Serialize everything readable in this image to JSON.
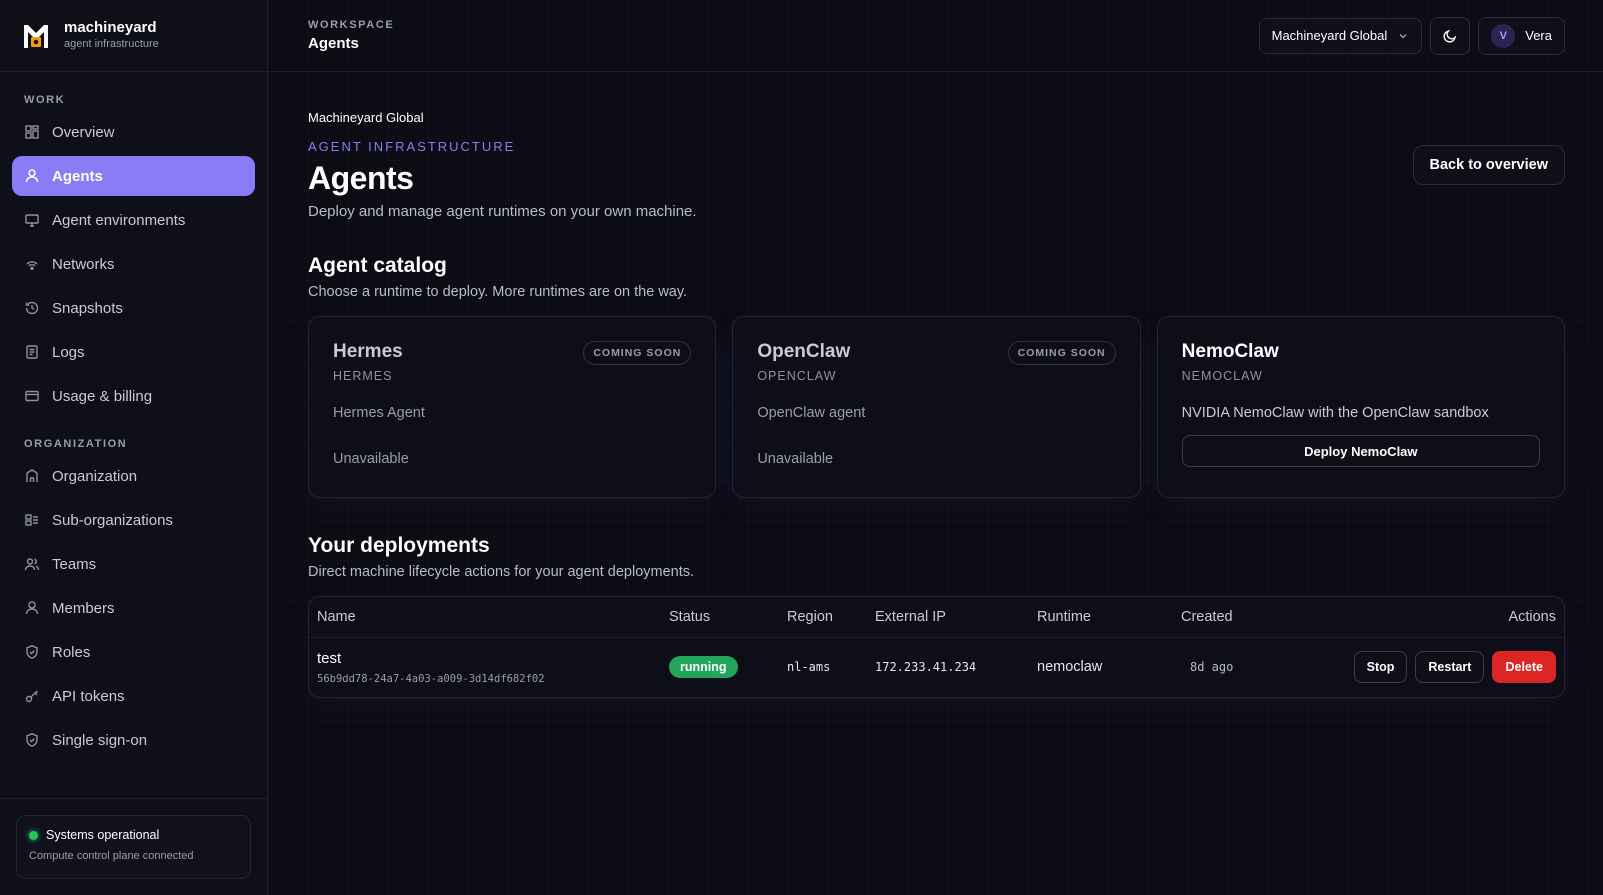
{
  "brand": {
    "name": "machineyard",
    "tagline": "agent infrastructure"
  },
  "sidebar": {
    "sections": [
      {
        "heading": "WORK",
        "items": [
          {
            "label": "Overview",
            "icon": "grid-icon"
          },
          {
            "label": "Agents",
            "icon": "user-icon",
            "active": true
          },
          {
            "label": "Agent environments",
            "icon": "monitor-icon"
          },
          {
            "label": "Networks",
            "icon": "wifi-icon"
          },
          {
            "label": "Snapshots",
            "icon": "history-icon"
          },
          {
            "label": "Logs",
            "icon": "document-icon"
          },
          {
            "label": "Usage & billing",
            "icon": "card-icon"
          }
        ]
      },
      {
        "heading": "ORGANIZATION",
        "items": [
          {
            "label": "Organization",
            "icon": "building-icon"
          },
          {
            "label": "Sub-organizations",
            "icon": "suborg-icon"
          },
          {
            "label": "Teams",
            "icon": "users-icon"
          },
          {
            "label": "Members",
            "icon": "user-icon"
          },
          {
            "label": "Roles",
            "icon": "shield-check-icon"
          },
          {
            "label": "API tokens",
            "icon": "key-icon"
          },
          {
            "label": "Single sign-on",
            "icon": "shield-check-icon"
          }
        ]
      }
    ],
    "status": {
      "title": "Systems operational",
      "detail": "Compute control plane connected"
    }
  },
  "topbar": {
    "crumb_label": "WORKSPACE",
    "crumb_title": "Agents",
    "org_select": "Machineyard Global",
    "user": {
      "initial": "V",
      "name": "Vera"
    }
  },
  "page": {
    "org_name": "Machineyard Global",
    "eyebrow": "AGENT INFRASTRUCTURE",
    "title": "Agents",
    "subtitle": "Deploy and manage agent runtimes on your own machine.",
    "back_button": "Back to overview"
  },
  "catalog": {
    "title": "Agent catalog",
    "subtitle": "Choose a runtime to deploy. More runtimes are on the way.",
    "cards": [
      {
        "name": "Hermes",
        "code": "HERMES",
        "description": "Hermes Agent",
        "badge": "COMING SOON",
        "status": "Unavailable"
      },
      {
        "name": "OpenClaw",
        "code": "OPENCLAW",
        "description": "OpenClaw agent",
        "badge": "COMING SOON",
        "status": "Unavailable"
      },
      {
        "name": "NemoClaw",
        "code": "NEMOCLAW",
        "description": "NVIDIA NemoClaw with the OpenClaw sandbox",
        "action": "Deploy NemoClaw"
      }
    ]
  },
  "deployments": {
    "title": "Your deployments",
    "subtitle": "Direct machine lifecycle actions for your agent deployments.",
    "columns": [
      "Name",
      "Status",
      "Region",
      "External IP",
      "Runtime",
      "Created",
      "Actions"
    ],
    "rows": [
      {
        "name": "test",
        "id": "56b9dd78-24a7-4a03-a009-3d14df682f02",
        "status": "running",
        "region": "nl-ams",
        "external_ip": "172.233.41.234",
        "runtime": "nemoclaw",
        "created": "8d ago",
        "actions": [
          "Stop",
          "Restart",
          "Delete"
        ]
      }
    ]
  },
  "colors": {
    "accent": "#8b7cf6",
    "running": "#22a55a",
    "danger": "#dc2626",
    "status_ok": "#22c55e"
  }
}
